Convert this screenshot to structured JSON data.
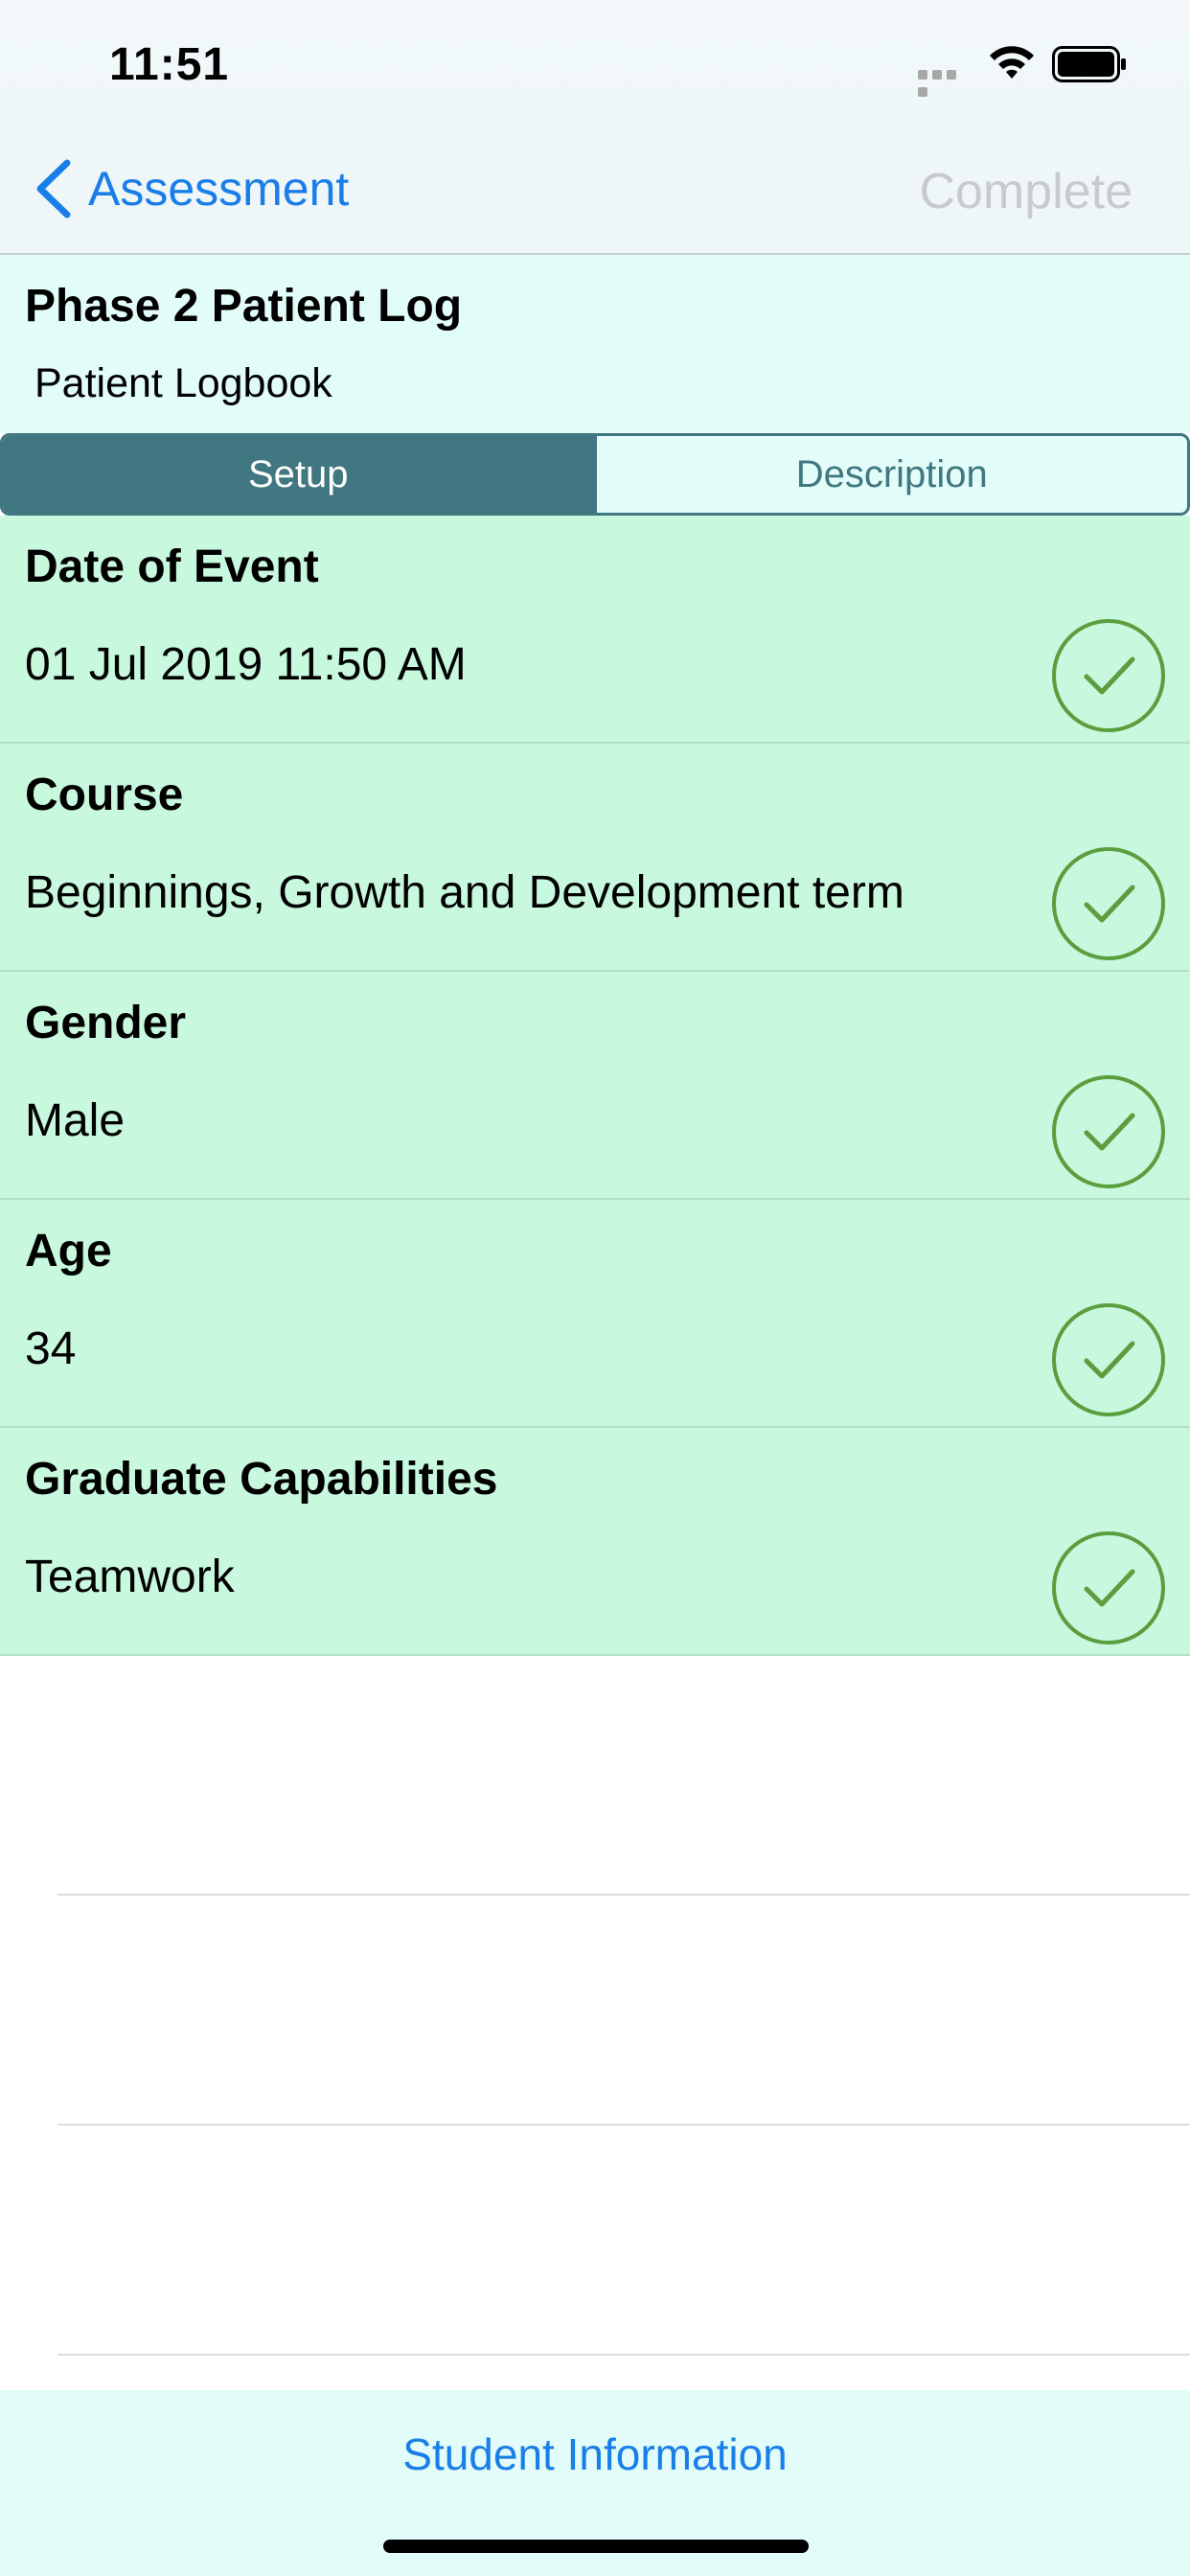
{
  "status_bar": {
    "time": "11:51"
  },
  "nav": {
    "back_label": "Assessment",
    "complete_label": "Complete"
  },
  "header": {
    "title": "Phase 2 Patient Log",
    "subtitle": "Patient Logbook"
  },
  "tabs": [
    {
      "label": "Setup",
      "selected": true
    },
    {
      "label": "Description",
      "selected": false
    }
  ],
  "rows": [
    {
      "label": "Date of Event",
      "value": "01 Jul 2019 11:50 AM",
      "status": "checkmark-icon"
    },
    {
      "label": "Course",
      "value": "Beginnings, Growth and Development term",
      "status": "checkmark-icon"
    },
    {
      "label": "Gender",
      "value": "Male",
      "status": "checkmark-icon"
    },
    {
      "label": "Age",
      "value": "34",
      "status": "checkmark-icon"
    },
    {
      "label": "Graduate Capabilities",
      "value": "Teamwork",
      "status": "checkmark-icon"
    }
  ],
  "footer": {
    "link_label": "Student Information"
  },
  "colors": {
    "accent": "#1a7ee8",
    "segment": "#417780",
    "row_background": "#c8f8dd",
    "check": "#5a9e3e"
  }
}
